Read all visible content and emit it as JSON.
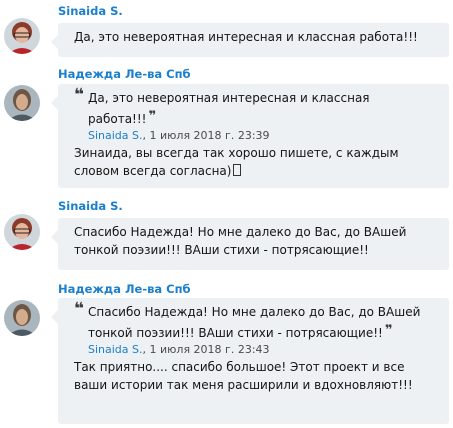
{
  "messages": [
    {
      "author": "Sinaida S.",
      "avatar": "avatar-sinaida",
      "text": "Да, это невероятная интересная и классная работа!!!"
    },
    {
      "author": "Надежда Ле-ва Спб",
      "avatar": "avatar-nadezhda",
      "quote": {
        "text": "Да, это невероятная интересная и классная работа!!!",
        "author": "Sinaida S.",
        "date": ", 1 июля 2018 г. 23:39"
      },
      "text": "Зинаида, вы всегда так хорошо пишете, с каждым словом всегда согласна)"
    },
    {
      "author": "Sinaida S.",
      "avatar": "avatar-sinaida",
      "text": "Спасибо Надежда! Но мне далеко до Вас, до ВАшей тонкой поэзии!!! ВАши стихи - потрясающие!!"
    },
    {
      "author": "Надежда Ле-ва Спб",
      "avatar": "avatar-nadezhda",
      "quote": {
        "text": "Спасибо Надежда! Но мне далеко до Вас, до ВАшей тонкой поэзии!!! ВАши стихи - потрясающие!!",
        "author": "Sinaida S.",
        "date": ", 1 июля 2018 г. 23:43"
      },
      "text": "Так приятно.... спасибо большое! Этот проект и все ваши истории так меня расширили и вдохновляют!!!"
    }
  ],
  "colors": {
    "link": "#1b7fcb",
    "bubble": "#eef1f4"
  },
  "icons": {
    "quote_open": "❝",
    "quote_close": "❞"
  }
}
